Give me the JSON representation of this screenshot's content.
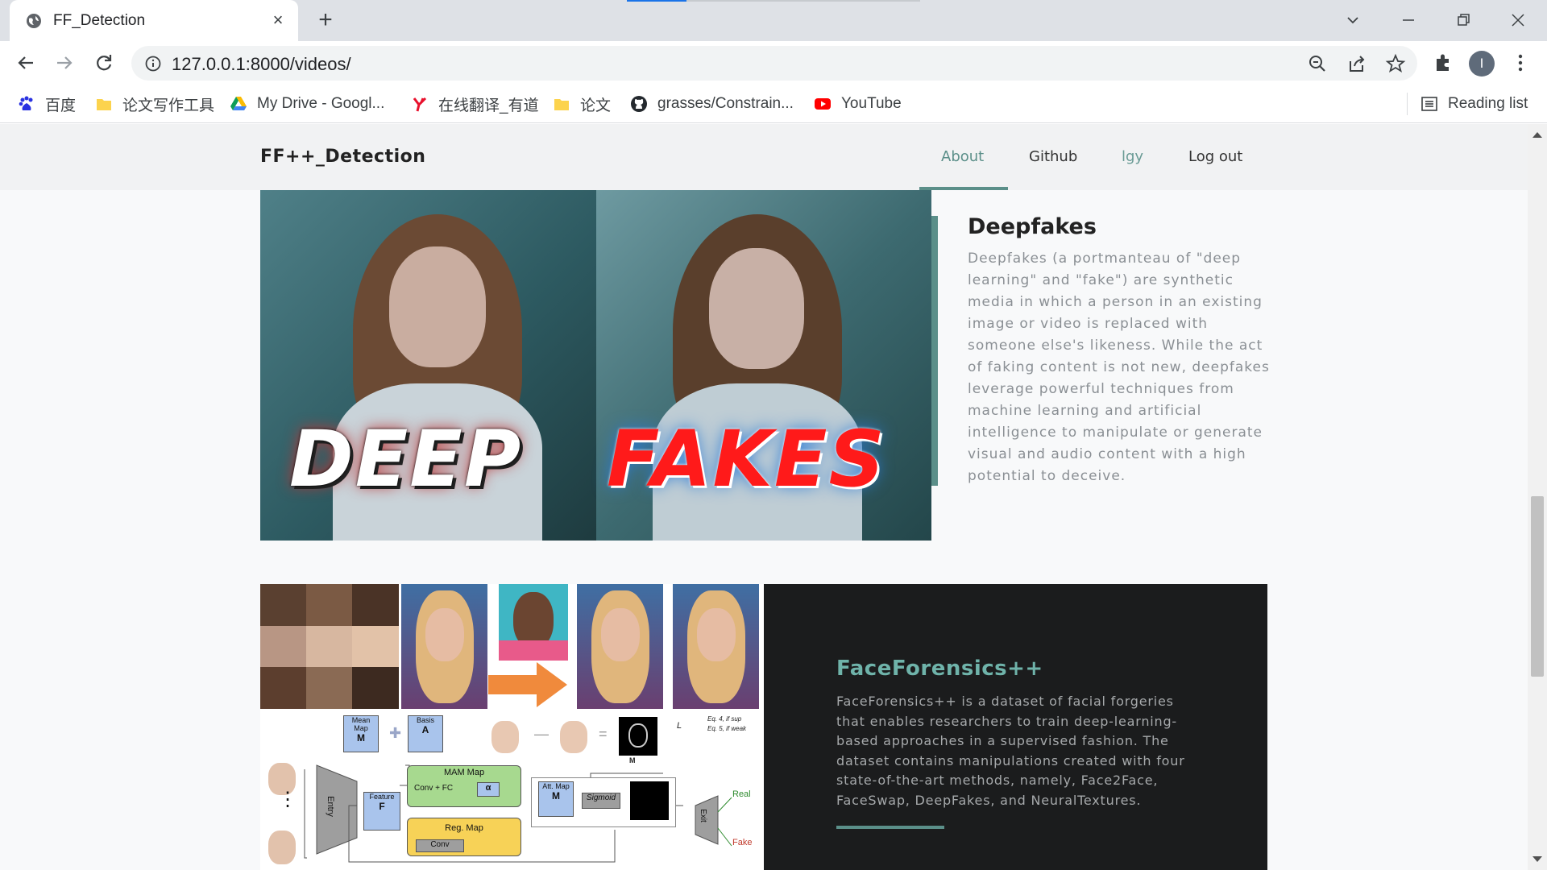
{
  "browser": {
    "tab_title": "FF_Detection",
    "url": "127.0.0.1:8000/videos/",
    "profile_initial": "I",
    "bookmarks": [
      {
        "label": "百度",
        "icon": "baidu-icon"
      },
      {
        "label": "论文写作工具",
        "icon": "folder-icon"
      },
      {
        "label": "My Drive - Googl...",
        "icon": "google-drive-icon"
      },
      {
        "label": "在线翻译_有道",
        "icon": "youdao-icon"
      },
      {
        "label": "论文",
        "icon": "folder-icon"
      },
      {
        "label": "grasses/Constrain...",
        "icon": "github-icon"
      },
      {
        "label": "YouTube",
        "icon": "youtube-icon"
      }
    ],
    "reading_list": "Reading list"
  },
  "navbar": {
    "brand": "FF++_Detection",
    "links": [
      "About",
      "Github",
      "lgy",
      "Log out"
    ],
    "active_link": "About"
  },
  "deepfakes": {
    "image_words": [
      "DEEP",
      "FAKES"
    ],
    "title": "Deepfakes",
    "text": "Deepfakes (a portmanteau of \"deep learning\" and \"fake\") are synthetic media in which a person in an existing image or video is replaced with someone else's likeness. While the act of faking content is not new, deepfakes leverage powerful techniques from machine learning and artificial intelligence to manipulate or generate visual and audio content with a high potential to deceive."
  },
  "faceforensics": {
    "title": "FaceForensics++",
    "text": "FaceForensics++ is a dataset of facial forgeries that enables researchers to train deep-learning-based approaches in a supervised fashion. The dataset contains manipulations created with four state-of-the-art methods, namely, Face2Face, FaceSwap, DeepFakes, and NeuralTextures.",
    "diagram_labels": {
      "mean_map": "Mean Map",
      "mean_m": "M",
      "basis": "Basis",
      "basis_a": "A",
      "mam_map": "MAM Map",
      "conv_fc": "Conv + FC",
      "alpha": "α",
      "reg_map": "Reg. Map",
      "conv": "Conv",
      "feature": "Feature",
      "feature_f": "F",
      "entry": "Entry",
      "att_map": "Att. Map",
      "m_att": "M",
      "sigmoid": "Sigmoid",
      "exit": "Exit",
      "real": "Real",
      "fake": "Fake",
      "eq4": "Eq. 4, if sup",
      "eq5": "Eq. 5, if weak",
      "l_map": "L",
      "m_gt": "M"
    }
  },
  "colors": {
    "accent": "#5b8f89",
    "teal_title": "#6fb3aa",
    "dark_panel": "#1b1c1d"
  }
}
